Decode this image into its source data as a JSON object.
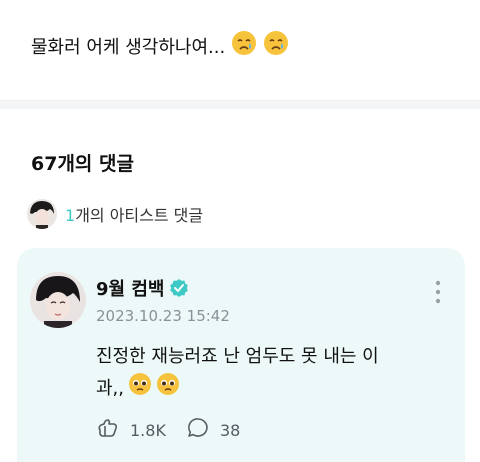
{
  "post": {
    "text": "물화러 어케 생각하나여...",
    "emojis": [
      "crying-face",
      "crying-face"
    ]
  },
  "comments": {
    "count_title": "67개의 댓글",
    "artist_count": "1",
    "artist_label": "개의 아티스트 댓글"
  },
  "comment": {
    "author": "9월 컴백",
    "verified": true,
    "date": "2023.10.23 15:42",
    "text_line1": "진정한 재능러죠 난 엄두도 못 내는 이",
    "text_line2": "과,,",
    "text_emojis": [
      "pleading-face",
      "pleading-face"
    ],
    "likes": "1.8K",
    "replies": "38"
  },
  "colors": {
    "accent": "#3ec9c6",
    "card_bg": "#edf9f8",
    "verified_badge": "#3ec9c6"
  }
}
